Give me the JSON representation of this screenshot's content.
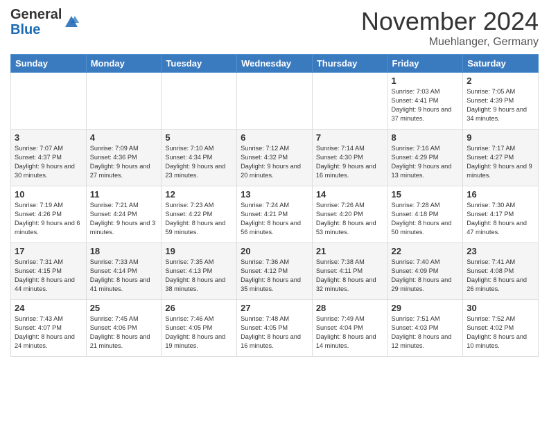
{
  "logo": {
    "general": "General",
    "blue": "Blue"
  },
  "title": "November 2024",
  "location": "Muehlanger, Germany",
  "days_header": [
    "Sunday",
    "Monday",
    "Tuesday",
    "Wednesday",
    "Thursday",
    "Friday",
    "Saturday"
  ],
  "weeks": [
    [
      {
        "day": "",
        "info": ""
      },
      {
        "day": "",
        "info": ""
      },
      {
        "day": "",
        "info": ""
      },
      {
        "day": "",
        "info": ""
      },
      {
        "day": "",
        "info": ""
      },
      {
        "day": "1",
        "info": "Sunrise: 7:03 AM\nSunset: 4:41 PM\nDaylight: 9 hours and 37 minutes."
      },
      {
        "day": "2",
        "info": "Sunrise: 7:05 AM\nSunset: 4:39 PM\nDaylight: 9 hours and 34 minutes."
      }
    ],
    [
      {
        "day": "3",
        "info": "Sunrise: 7:07 AM\nSunset: 4:37 PM\nDaylight: 9 hours and 30 minutes."
      },
      {
        "day": "4",
        "info": "Sunrise: 7:09 AM\nSunset: 4:36 PM\nDaylight: 9 hours and 27 minutes."
      },
      {
        "day": "5",
        "info": "Sunrise: 7:10 AM\nSunset: 4:34 PM\nDaylight: 9 hours and 23 minutes."
      },
      {
        "day": "6",
        "info": "Sunrise: 7:12 AM\nSunset: 4:32 PM\nDaylight: 9 hours and 20 minutes."
      },
      {
        "day": "7",
        "info": "Sunrise: 7:14 AM\nSunset: 4:30 PM\nDaylight: 9 hours and 16 minutes."
      },
      {
        "day": "8",
        "info": "Sunrise: 7:16 AM\nSunset: 4:29 PM\nDaylight: 9 hours and 13 minutes."
      },
      {
        "day": "9",
        "info": "Sunrise: 7:17 AM\nSunset: 4:27 PM\nDaylight: 9 hours and 9 minutes."
      }
    ],
    [
      {
        "day": "10",
        "info": "Sunrise: 7:19 AM\nSunset: 4:26 PM\nDaylight: 9 hours and 6 minutes."
      },
      {
        "day": "11",
        "info": "Sunrise: 7:21 AM\nSunset: 4:24 PM\nDaylight: 9 hours and 3 minutes."
      },
      {
        "day": "12",
        "info": "Sunrise: 7:23 AM\nSunset: 4:22 PM\nDaylight: 8 hours and 59 minutes."
      },
      {
        "day": "13",
        "info": "Sunrise: 7:24 AM\nSunset: 4:21 PM\nDaylight: 8 hours and 56 minutes."
      },
      {
        "day": "14",
        "info": "Sunrise: 7:26 AM\nSunset: 4:20 PM\nDaylight: 8 hours and 53 minutes."
      },
      {
        "day": "15",
        "info": "Sunrise: 7:28 AM\nSunset: 4:18 PM\nDaylight: 8 hours and 50 minutes."
      },
      {
        "day": "16",
        "info": "Sunrise: 7:30 AM\nSunset: 4:17 PM\nDaylight: 8 hours and 47 minutes."
      }
    ],
    [
      {
        "day": "17",
        "info": "Sunrise: 7:31 AM\nSunset: 4:15 PM\nDaylight: 8 hours and 44 minutes."
      },
      {
        "day": "18",
        "info": "Sunrise: 7:33 AM\nSunset: 4:14 PM\nDaylight: 8 hours and 41 minutes."
      },
      {
        "day": "19",
        "info": "Sunrise: 7:35 AM\nSunset: 4:13 PM\nDaylight: 8 hours and 38 minutes."
      },
      {
        "day": "20",
        "info": "Sunrise: 7:36 AM\nSunset: 4:12 PM\nDaylight: 8 hours and 35 minutes."
      },
      {
        "day": "21",
        "info": "Sunrise: 7:38 AM\nSunset: 4:11 PM\nDaylight: 8 hours and 32 minutes."
      },
      {
        "day": "22",
        "info": "Sunrise: 7:40 AM\nSunset: 4:09 PM\nDaylight: 8 hours and 29 minutes."
      },
      {
        "day": "23",
        "info": "Sunrise: 7:41 AM\nSunset: 4:08 PM\nDaylight: 8 hours and 26 minutes."
      }
    ],
    [
      {
        "day": "24",
        "info": "Sunrise: 7:43 AM\nSunset: 4:07 PM\nDaylight: 8 hours and 24 minutes."
      },
      {
        "day": "25",
        "info": "Sunrise: 7:45 AM\nSunset: 4:06 PM\nDaylight: 8 hours and 21 minutes."
      },
      {
        "day": "26",
        "info": "Sunrise: 7:46 AM\nSunset: 4:05 PM\nDaylight: 8 hours and 19 minutes."
      },
      {
        "day": "27",
        "info": "Sunrise: 7:48 AM\nSunset: 4:05 PM\nDaylight: 8 hours and 16 minutes."
      },
      {
        "day": "28",
        "info": "Sunrise: 7:49 AM\nSunset: 4:04 PM\nDaylight: 8 hours and 14 minutes."
      },
      {
        "day": "29",
        "info": "Sunrise: 7:51 AM\nSunset: 4:03 PM\nDaylight: 8 hours and 12 minutes."
      },
      {
        "day": "30",
        "info": "Sunrise: 7:52 AM\nSunset: 4:02 PM\nDaylight: 8 hours and 10 minutes."
      }
    ]
  ]
}
